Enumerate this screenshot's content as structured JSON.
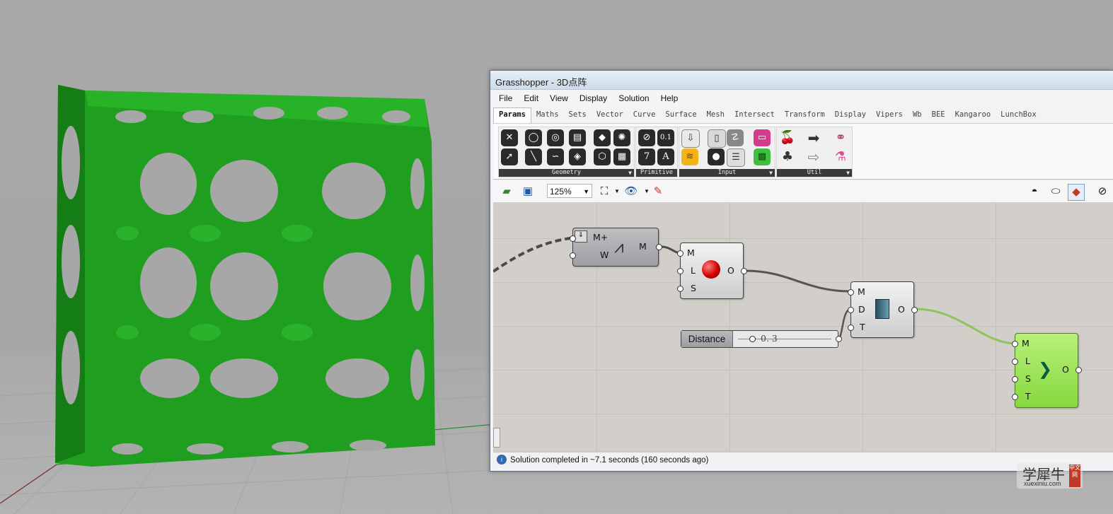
{
  "window": {
    "title": "Grasshopper - 3D点阵"
  },
  "menu": [
    "File",
    "Edit",
    "View",
    "Display",
    "Solution",
    "Help"
  ],
  "tabs": [
    "Params",
    "Maths",
    "Sets",
    "Vector",
    "Curve",
    "Surface",
    "Mesh",
    "Intersect",
    "Transform",
    "Display",
    "Vipers",
    "Wb",
    "BEE",
    "Kangaroo",
    "LunchBox"
  ],
  "active_tab": "Params",
  "ribbon_groups": {
    "geometry": "Geometry",
    "primitive": "Primitive",
    "input": "Input",
    "util": "Util"
  },
  "primitive_icons": {
    "integer": "7",
    "text": "A",
    "number": "0.1"
  },
  "toolbar": {
    "zoom": "125%"
  },
  "components": {
    "mesh_join": {
      "inputs": [
        "M+",
        "W"
      ],
      "output": "M"
    },
    "smooth_mesh": {
      "inputs": [
        "M",
        "L",
        "S"
      ],
      "output": "O"
    },
    "thicken": {
      "inputs": [
        "M",
        "D",
        "T"
      ],
      "output": "O"
    },
    "subdivide": {
      "inputs": [
        "M",
        "L",
        "S",
        "T"
      ],
      "output": "O"
    }
  },
  "slider": {
    "label": "Distance",
    "value": "0. 3"
  },
  "status": {
    "text": "Solution completed in ~7.1 seconds (160 seconds ago)"
  },
  "watermark": {
    "chinese": "学犀牛",
    "url": "xuexiniu.com",
    "badge": "中文网"
  },
  "colors": {
    "mesh_green": "#1aa31a",
    "component_green": "#9ae45a",
    "wire_active": "#8ec45a"
  }
}
